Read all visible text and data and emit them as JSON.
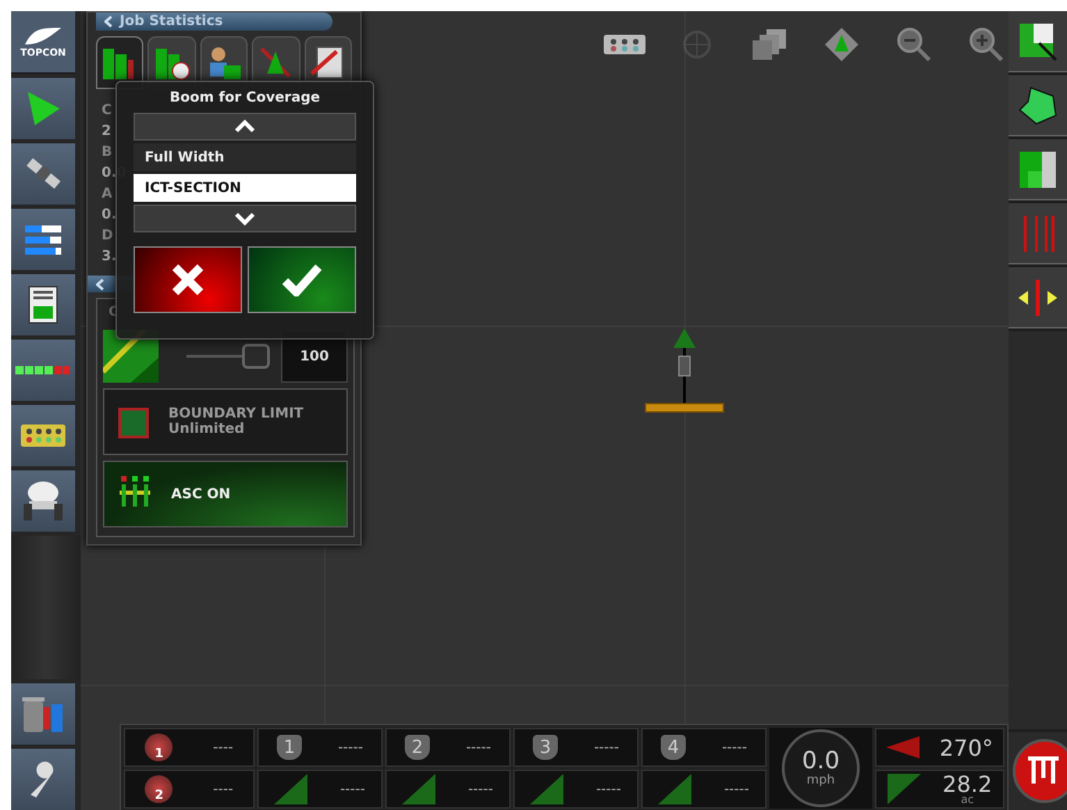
{
  "sidebar": {
    "items": [
      {
        "kind": "logo",
        "text": "TOPCON"
      },
      {
        "kind": "guidance"
      },
      {
        "kind": "satellite"
      },
      {
        "kind": "bars"
      },
      {
        "kind": "document"
      },
      {
        "kind": "sections"
      },
      {
        "kind": "module"
      },
      {
        "kind": "sprayer"
      }
    ],
    "bottom_items": [
      {
        "kind": "storage"
      },
      {
        "kind": "wrench"
      }
    ]
  },
  "map_toolbar": [
    {
      "kind": "module",
      "disabled": false
    },
    {
      "kind": "crosshair",
      "disabled": true
    },
    {
      "kind": "layers",
      "disabled": false
    },
    {
      "kind": "view",
      "disabled": false
    },
    {
      "kind": "zoom_out",
      "disabled": false
    },
    {
      "kind": "zoom_in",
      "disabled": false
    }
  ],
  "job_panel": {
    "title": "Job Statistics",
    "tabs": [
      {
        "kind": "coverage",
        "selected": true
      },
      {
        "kind": "time",
        "selected": false
      },
      {
        "kind": "operator",
        "selected": false
      },
      {
        "kind": "guidance",
        "selected": false
      },
      {
        "kind": "notes",
        "selected": false
      }
    ],
    "stats": [
      "C",
      "2",
      "B",
      "0.0",
      "A",
      "0.",
      "D",
      "3."
    ],
    "control_label": "C",
    "slider": {
      "level": 0.86,
      "value": "100"
    },
    "boundary": {
      "label": "BOUNDARY LIMIT",
      "value": "Unlimited"
    },
    "asc": {
      "label": "ASC ON",
      "on": true
    }
  },
  "popup": {
    "title": "Boom for Coverage",
    "options": [
      {
        "label": "Full Width",
        "selected": false
      },
      {
        "label": "ICT-SECTION",
        "selected": true
      }
    ]
  },
  "right_sidebar": [
    {
      "kind": "field"
    },
    {
      "kind": "boundary"
    },
    {
      "kind": "headland"
    },
    {
      "kind": "lines"
    },
    {
      "kind": "shift"
    }
  ],
  "bottom_bar": {
    "rates": [
      {
        "badge": "1",
        "value": "----"
      },
      {
        "badge": "2",
        "value": "----"
      }
    ],
    "sections": [
      {
        "number": "1",
        "top": "-----",
        "bottom": "-----"
      },
      {
        "number": "2",
        "top": "-----",
        "bottom": "-----"
      },
      {
        "number": "3",
        "top": "-----",
        "bottom": "-----"
      },
      {
        "number": "4",
        "top": "-----",
        "bottom": "-----"
      }
    ],
    "speed": {
      "value": "0.0",
      "unit": "mph"
    },
    "heading": "270°",
    "area": {
      "value": "28.2",
      "unit": "ac"
    }
  }
}
